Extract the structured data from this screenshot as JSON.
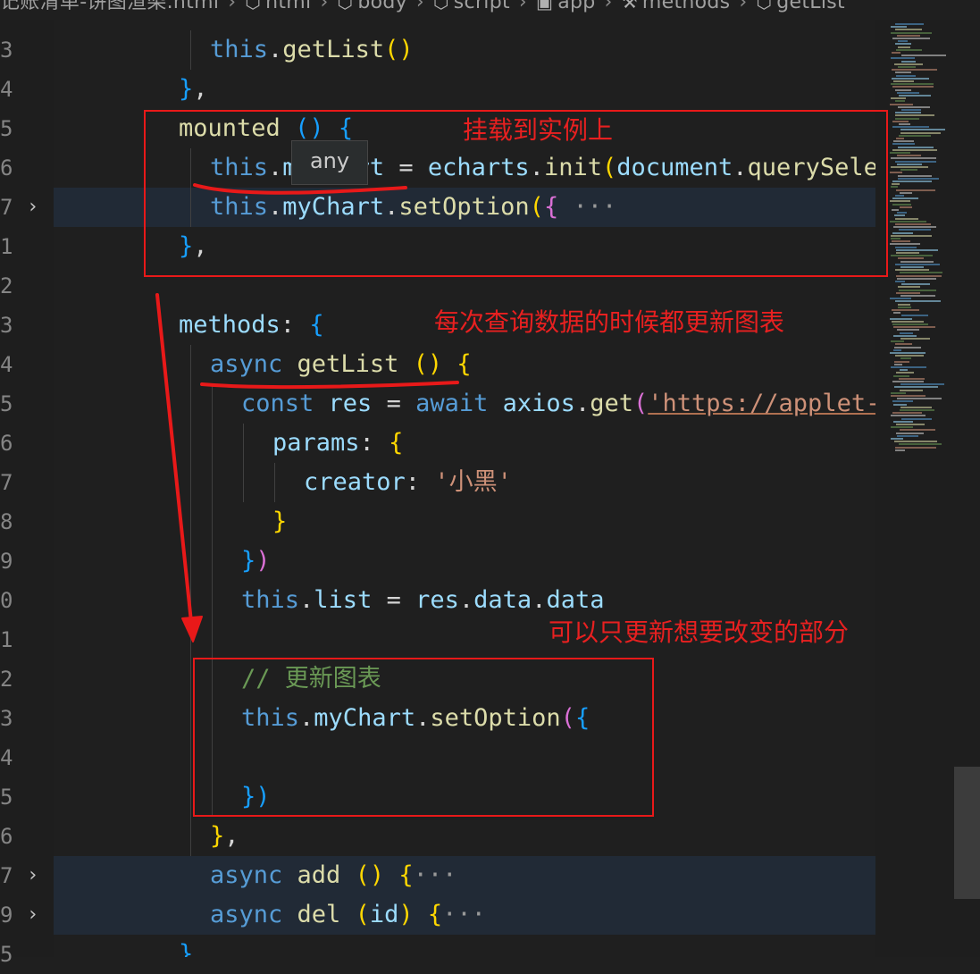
{
  "breadcrumb": [
    {
      "label": "记账清单-饼图渲染.html",
      "icon": ""
    },
    {
      "label": "html",
      "icon": "cube-icon"
    },
    {
      "label": "body",
      "icon": "cube-icon"
    },
    {
      "label": "script",
      "icon": "cube-icon"
    },
    {
      "label": "app",
      "icon": "variable-icon"
    },
    {
      "label": "methods",
      "icon": "wrench-icon"
    },
    {
      "label": "getList",
      "icon": "cube-icon"
    }
  ],
  "gutter": [
    {
      "num": "3",
      "fold": false
    },
    {
      "num": "4",
      "fold": false
    },
    {
      "num": "5",
      "fold": false
    },
    {
      "num": "6",
      "fold": false
    },
    {
      "num": "7",
      "fold": true
    },
    {
      "num": "1",
      "fold": false
    },
    {
      "num": "2",
      "fold": false
    },
    {
      "num": "3",
      "fold": false
    },
    {
      "num": "4",
      "fold": false
    },
    {
      "num": "5",
      "fold": false
    },
    {
      "num": "6",
      "fold": false
    },
    {
      "num": "7",
      "fold": false
    },
    {
      "num": "8",
      "fold": false
    },
    {
      "num": "9",
      "fold": false
    },
    {
      "num": "0",
      "fold": false
    },
    {
      "num": "1",
      "fold": false
    },
    {
      "num": "2",
      "fold": false
    },
    {
      "num": "3",
      "fold": false
    },
    {
      "num": "4",
      "fold": false
    },
    {
      "num": "5",
      "fold": false
    },
    {
      "num": "6",
      "fold": false
    },
    {
      "num": "7",
      "fold": true
    },
    {
      "num": "9",
      "fold": true
    },
    {
      "num": "5",
      "fold": false
    }
  ],
  "code": [
    [
      {
        "t": "this",
        "c": "kw"
      },
      {
        "t": ".",
        "c": "pl"
      },
      {
        "t": "getList",
        "c": "fn"
      },
      {
        "t": "()",
        "c": "b1"
      }
    ],
    [
      {
        "t": "}",
        "c": "b3"
      },
      {
        "t": ",",
        "c": "pl"
      }
    ],
    [
      {
        "t": "mounted",
        "c": "fn"
      },
      {
        "t": " ",
        "c": "pl"
      },
      {
        "t": "()",
        "c": "b3"
      },
      {
        "t": " ",
        "c": "pl"
      },
      {
        "t": "{",
        "c": "b3"
      }
    ],
    [
      {
        "t": "this",
        "c": "kw"
      },
      {
        "t": ".",
        "c": "pl"
      },
      {
        "t": "myChart",
        "c": "prop"
      },
      {
        "t": " = ",
        "c": "pl"
      },
      {
        "t": "echarts",
        "c": "prop"
      },
      {
        "t": ".",
        "c": "pl"
      },
      {
        "t": "init",
        "c": "fn"
      },
      {
        "t": "(",
        "c": "b1"
      },
      {
        "t": "document",
        "c": "prop"
      },
      {
        "t": ".",
        "c": "pl"
      },
      {
        "t": "querySelector",
        "c": "fn"
      }
    ],
    [
      {
        "t": "this",
        "c": "kw"
      },
      {
        "t": ".",
        "c": "pl"
      },
      {
        "t": "myChart",
        "c": "prop"
      },
      {
        "t": ".",
        "c": "pl"
      },
      {
        "t": "setOption",
        "c": "fn"
      },
      {
        "t": "(",
        "c": "b1"
      },
      {
        "t": "{",
        "c": "b2"
      },
      {
        "t": " ···",
        "c": "ell"
      }
    ],
    [
      {
        "t": "}",
        "c": "b3"
      },
      {
        "t": ",",
        "c": "pl"
      }
    ],
    [],
    [
      {
        "t": "methods",
        "c": "prop"
      },
      {
        "t": ": ",
        "c": "pl"
      },
      {
        "t": "{",
        "c": "b3"
      }
    ],
    [
      {
        "t": "async",
        "c": "kw"
      },
      {
        "t": " ",
        "c": "pl"
      },
      {
        "t": "getList",
        "c": "fn"
      },
      {
        "t": " ",
        "c": "pl"
      },
      {
        "t": "()",
        "c": "b1"
      },
      {
        "t": " ",
        "c": "pl"
      },
      {
        "t": "{",
        "c": "b1"
      }
    ],
    [
      {
        "t": "const",
        "c": "kw"
      },
      {
        "t": " ",
        "c": "pl"
      },
      {
        "t": "res",
        "c": "prop"
      },
      {
        "t": " = ",
        "c": "pl"
      },
      {
        "t": "await",
        "c": "kw"
      },
      {
        "t": " ",
        "c": "pl"
      },
      {
        "t": "axios",
        "c": "prop"
      },
      {
        "t": ".",
        "c": "pl"
      },
      {
        "t": "get",
        "c": "fn"
      },
      {
        "t": "(",
        "c": "b2"
      },
      {
        "t": "'https://applet-base-api",
        "c": "str url"
      }
    ],
    [
      {
        "t": "params",
        "c": "prop"
      },
      {
        "t": ": ",
        "c": "pl"
      },
      {
        "t": "{",
        "c": "b1"
      }
    ],
    [
      {
        "t": "creator",
        "c": "prop"
      },
      {
        "t": ": ",
        "c": "pl"
      },
      {
        "t": "'小黑'",
        "c": "str"
      }
    ],
    [
      {
        "t": "}",
        "c": "b1"
      }
    ],
    [
      {
        "t": "}",
        "c": "b3"
      },
      {
        "t": ")",
        "c": "b2"
      }
    ],
    [
      {
        "t": "this",
        "c": "kw"
      },
      {
        "t": ".",
        "c": "pl"
      },
      {
        "t": "list",
        "c": "prop"
      },
      {
        "t": " = ",
        "c": "pl"
      },
      {
        "t": "res",
        "c": "prop"
      },
      {
        "t": ".",
        "c": "pl"
      },
      {
        "t": "data",
        "c": "prop"
      },
      {
        "t": ".",
        "c": "pl"
      },
      {
        "t": "data",
        "c": "prop"
      }
    ],
    [],
    [
      {
        "t": "// 更新图表",
        "c": "cm"
      }
    ],
    [
      {
        "t": "this",
        "c": "kw"
      },
      {
        "t": ".",
        "c": "pl"
      },
      {
        "t": "myChart",
        "c": "prop"
      },
      {
        "t": ".",
        "c": "pl"
      },
      {
        "t": "setOption",
        "c": "fn"
      },
      {
        "t": "(",
        "c": "b2"
      },
      {
        "t": "{",
        "c": "b3"
      }
    ],
    [],
    [
      {
        "t": "})",
        "c": "b3"
      }
    ],
    [
      {
        "t": "}",
        "c": "b1"
      },
      {
        "t": ",",
        "c": "pl"
      }
    ],
    [
      {
        "t": "async",
        "c": "kw"
      },
      {
        "t": " ",
        "c": "pl"
      },
      {
        "t": "add",
        "c": "fn"
      },
      {
        "t": " ",
        "c": "pl"
      },
      {
        "t": "()",
        "c": "b1"
      },
      {
        "t": " ",
        "c": "pl"
      },
      {
        "t": "{",
        "c": "b1"
      },
      {
        "t": "···",
        "c": "ell"
      }
    ],
    [
      {
        "t": "async",
        "c": "kw"
      },
      {
        "t": " ",
        "c": "pl"
      },
      {
        "t": "del",
        "c": "fn"
      },
      {
        "t": " ",
        "c": "pl"
      },
      {
        "t": "(",
        "c": "b1"
      },
      {
        "t": "id",
        "c": "prop"
      },
      {
        "t": ")",
        "c": "b1"
      },
      {
        "t": " ",
        "c": "pl"
      },
      {
        "t": "{",
        "c": "b1"
      },
      {
        "t": "···",
        "c": "ell"
      }
    ],
    [
      {
        "t": "}",
        "c": "b3"
      }
    ]
  ],
  "tooltip": {
    "text": "any"
  },
  "annotations": {
    "mounted_note": "挂载到实例上",
    "methods_note": "每次查询数据的时候都更新图表",
    "partial_note": "可以只更新想要改变的部分"
  },
  "colors": {
    "background": "#1f1f1f",
    "keyword": "#569cd6",
    "property": "#9cdcfe",
    "function": "#dcdcaa",
    "string": "#ce9178",
    "comment": "#6a9955",
    "annotation_red": "#e81919",
    "highlight_row": "#212a36"
  }
}
